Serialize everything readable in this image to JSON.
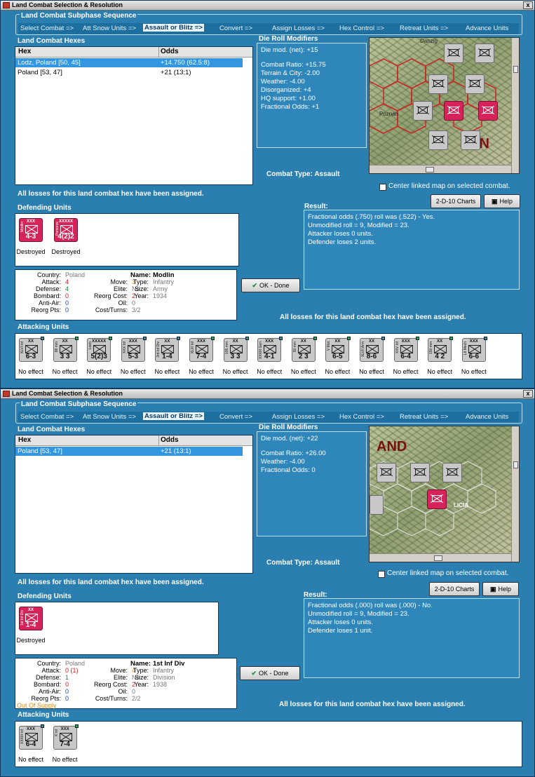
{
  "panels": [
    {
      "window_title": "Land Combat Selection & Resolution",
      "sequence_title": "Land Combat Subphase Sequence",
      "sequence": [
        "Select Combat =>",
        "Att Snow Units =>",
        "Assault or Blitz =>",
        "Convert =>",
        "Assign Losses =>",
        "Hex Control =>",
        "Retreat Units =>",
        "Advance Units"
      ],
      "sequence_selected": 2,
      "hexes_title": "Land Combat Hexes",
      "col_hex": "Hex",
      "col_odds": "Odds",
      "hexes": [
        {
          "hex": "Lodz, Poland [50, 45]",
          "odds": "+14.750 (62.5:8)",
          "selected": true
        },
        {
          "hex": "Poland [53, 47]",
          "odds": "+21 (13:1)",
          "selected": false
        }
      ],
      "die_title": "Die Roll Modifiers",
      "die_lines": [
        "Die mod. (net): +15",
        "",
        "Combat Ratio: +15.75",
        "Terrain & City: -2.00",
        "Weather: -4.00",
        "Disorganized: +4",
        "HQ support: +1.00",
        "Fractional Odds: +1"
      ],
      "combat_type": "Combat Type:  Assault",
      "map_label": "AN",
      "map_city": "Poznan",
      "map_city2": "Danzig",
      "center_map": "Center linked map on selected combat.",
      "btn_charts": "2-D-10 Charts",
      "btn_help": "Help",
      "losses_msg": "All losses for this land combat hex have been assigned.",
      "result_title": "Result:",
      "result_lines": [
        "Fractional odds (.750) roll was (.522)  - Yes.",
        "Unmodified roll = 9, Modified = 23.",
        "Attacker loses 0 units.",
        "Defender loses 2 units."
      ],
      "defending_title": "Defending Units",
      "defenders": [
        {
          "size": "XXX",
          "strength": "4-3",
          "side": "Modlin",
          "status": "Destroyed"
        },
        {
          "size": "XXXXX",
          "strength": "4(2)2",
          "side": "Pomorze",
          "status": "Destroyed"
        }
      ],
      "info": {
        "country_l": "Country:",
        "country_v": "Poland",
        "attack_l": "Attack:",
        "attack_v": "4",
        "defense_l": "Defense:",
        "defense_v": "4",
        "bombard_l": "Bombard:",
        "bombard_v": "0",
        "antiair_l": "Anti-Air:",
        "antiair_v": "0",
        "reorgpts_l": "Reorg Pts:",
        "reorgpts_v": "0",
        "move_l": "Move:",
        "move_v": "3",
        "elite_l": "Elite:",
        "elite_v": "No",
        "reorgcost_l": "Reorg Cost:",
        "reorgcost_v": "2",
        "oil_l": "Oil:",
        "oil_v": "0",
        "costturns_l": "Cost/Turns:",
        "costturns_v": "3/2",
        "name_l": "Name:",
        "name_v": "Modlin",
        "type_l": "Type:",
        "type_v": "Infantry",
        "size_l": "Size:",
        "size_v": "Army",
        "year_l": "Year:",
        "year_v": "1934",
        "supply": ""
      },
      "btn_ok": "OK - Done",
      "attacking_title": "Attacking Units",
      "attackers": [
        {
          "size": "XX",
          "strength": "6-3",
          "side": "XLVI Inf",
          "status": "No effect"
        },
        {
          "size": "XX",
          "strength": "3 3",
          "side": "88 mm",
          "status": "No effect"
        },
        {
          "size": "XXXXX",
          "strength": "5(2)3",
          "side": "Loeb",
          "status": "No effect"
        },
        {
          "size": "XXX",
          "strength": "5-3",
          "side": "XXX Inf",
          "status": "No effect"
        },
        {
          "size": "XX",
          "strength": "1-4",
          "side": "3rd Inf Div",
          "status": "No effect"
        },
        {
          "size": "XXX",
          "strength": "7-4",
          "side": "XLIII Inf",
          "status": "No effect"
        },
        {
          "size": "XX",
          "strength": "3 3",
          "side": "105 mm",
          "status": "No effect"
        },
        {
          "size": "XXX",
          "strength": "4-1",
          "side": "XXXIII Gen",
          "status": "No effect"
        },
        {
          "size": "XX",
          "strength": "2 3",
          "side": "50 mm",
          "status": "No effect"
        },
        {
          "size": "XX",
          "strength": "6-5",
          "side": "V Mot",
          "status": "No effect"
        },
        {
          "size": "XX",
          "strength": "8-6",
          "side": "XLVII Arm",
          "status": "No effect"
        },
        {
          "size": "XXX",
          "strength": "6-4",
          "side": "XXV Inf",
          "status": "No effect"
        },
        {
          "size": "XX",
          "strength": "4 2",
          "side": "150 mm",
          "status": "No effect"
        },
        {
          "size": "XXX",
          "strength": "6-6",
          "side": "LII Mech",
          "status": "No effect"
        }
      ]
    },
    {
      "window_title": "Land Combat Selection & Resolution",
      "sequence_title": "Land Combat Subphase Sequence",
      "sequence": [
        "Select Combat =>",
        "Att Snow Units =>",
        "Assault or Blitz =>",
        "Convert =>",
        "Assign Losses =>",
        "Hex Control =>",
        "Retreat Units =>",
        "Advance Units"
      ],
      "sequence_selected": 2,
      "hexes_title": "Land Combat Hexes",
      "col_hex": "Hex",
      "col_odds": "Odds",
      "hexes": [
        {
          "hex": "Poland [53, 47]",
          "odds": "+21 (13:1)",
          "selected": true
        }
      ],
      "die_title": "Die Roll Modifiers",
      "die_lines": [
        "Die mod. (net): +22",
        "",
        "Combat Ratio: +26.00",
        "Weather: -4.00",
        "Fractional Odds: 0"
      ],
      "combat_type": "Combat Type:  Assault",
      "map_label": "AND",
      "map_city": "LICIA",
      "map_city2": "",
      "center_map": "Center linked map on selected combat.",
      "btn_charts": "2-D-10 Charts",
      "btn_help": "Help",
      "losses_msg": "All losses for this land combat hex have been assigned.",
      "result_title": "Result:",
      "result_lines": [
        "Fractional odds (.000) roll was (.000)  - No.",
        "Unmodified roll = 9, Modified = 23.",
        "Attacker loses 0 units.",
        "Defender loses 1 unit."
      ],
      "defending_title": "Defending Units",
      "defenders": [
        {
          "size": "XX",
          "strength": "1-4",
          "side": "1st Inf Div",
          "status": "Destroyed"
        }
      ],
      "info": {
        "country_l": "Country:",
        "country_v": "Poland",
        "attack_l": "Attack:",
        "attack_v": "0 (1)",
        "defense_l": "Defense:",
        "defense_v": "1",
        "bombard_l": "Bombard:",
        "bombard_v": "0",
        "antiair_l": "Anti-Air:",
        "antiair_v": "0",
        "reorgpts_l": "Reorg Pts:",
        "reorgpts_v": "0",
        "move_l": "Move:",
        "move_v": "4",
        "elite_l": "Elite:",
        "elite_v": "No",
        "reorgcost_l": "Reorg Cost:",
        "reorgcost_v": "2",
        "oil_l": "Oil:",
        "oil_v": "0",
        "costturns_l": "Cost/Turns:",
        "costturns_v": "2/2",
        "name_l": "Name:",
        "name_v": "1st Inf Div",
        "type_l": "Type:",
        "type_v": "Infantry",
        "size_l": "Size:",
        "size_v": "Division",
        "year_l": "Year:",
        "year_v": "1938",
        "supply": "Out Of Supply"
      },
      "btn_ok": "OK - Done",
      "attacking_title": "Attacking Units",
      "attackers": [
        {
          "size": "XXX",
          "strength": "6-4",
          "side": "XXXIII Inf",
          "status": "No effect"
        },
        {
          "size": "XXX",
          "strength": "7-4",
          "side": "X Inf",
          "status": "No effect"
        }
      ]
    }
  ]
}
